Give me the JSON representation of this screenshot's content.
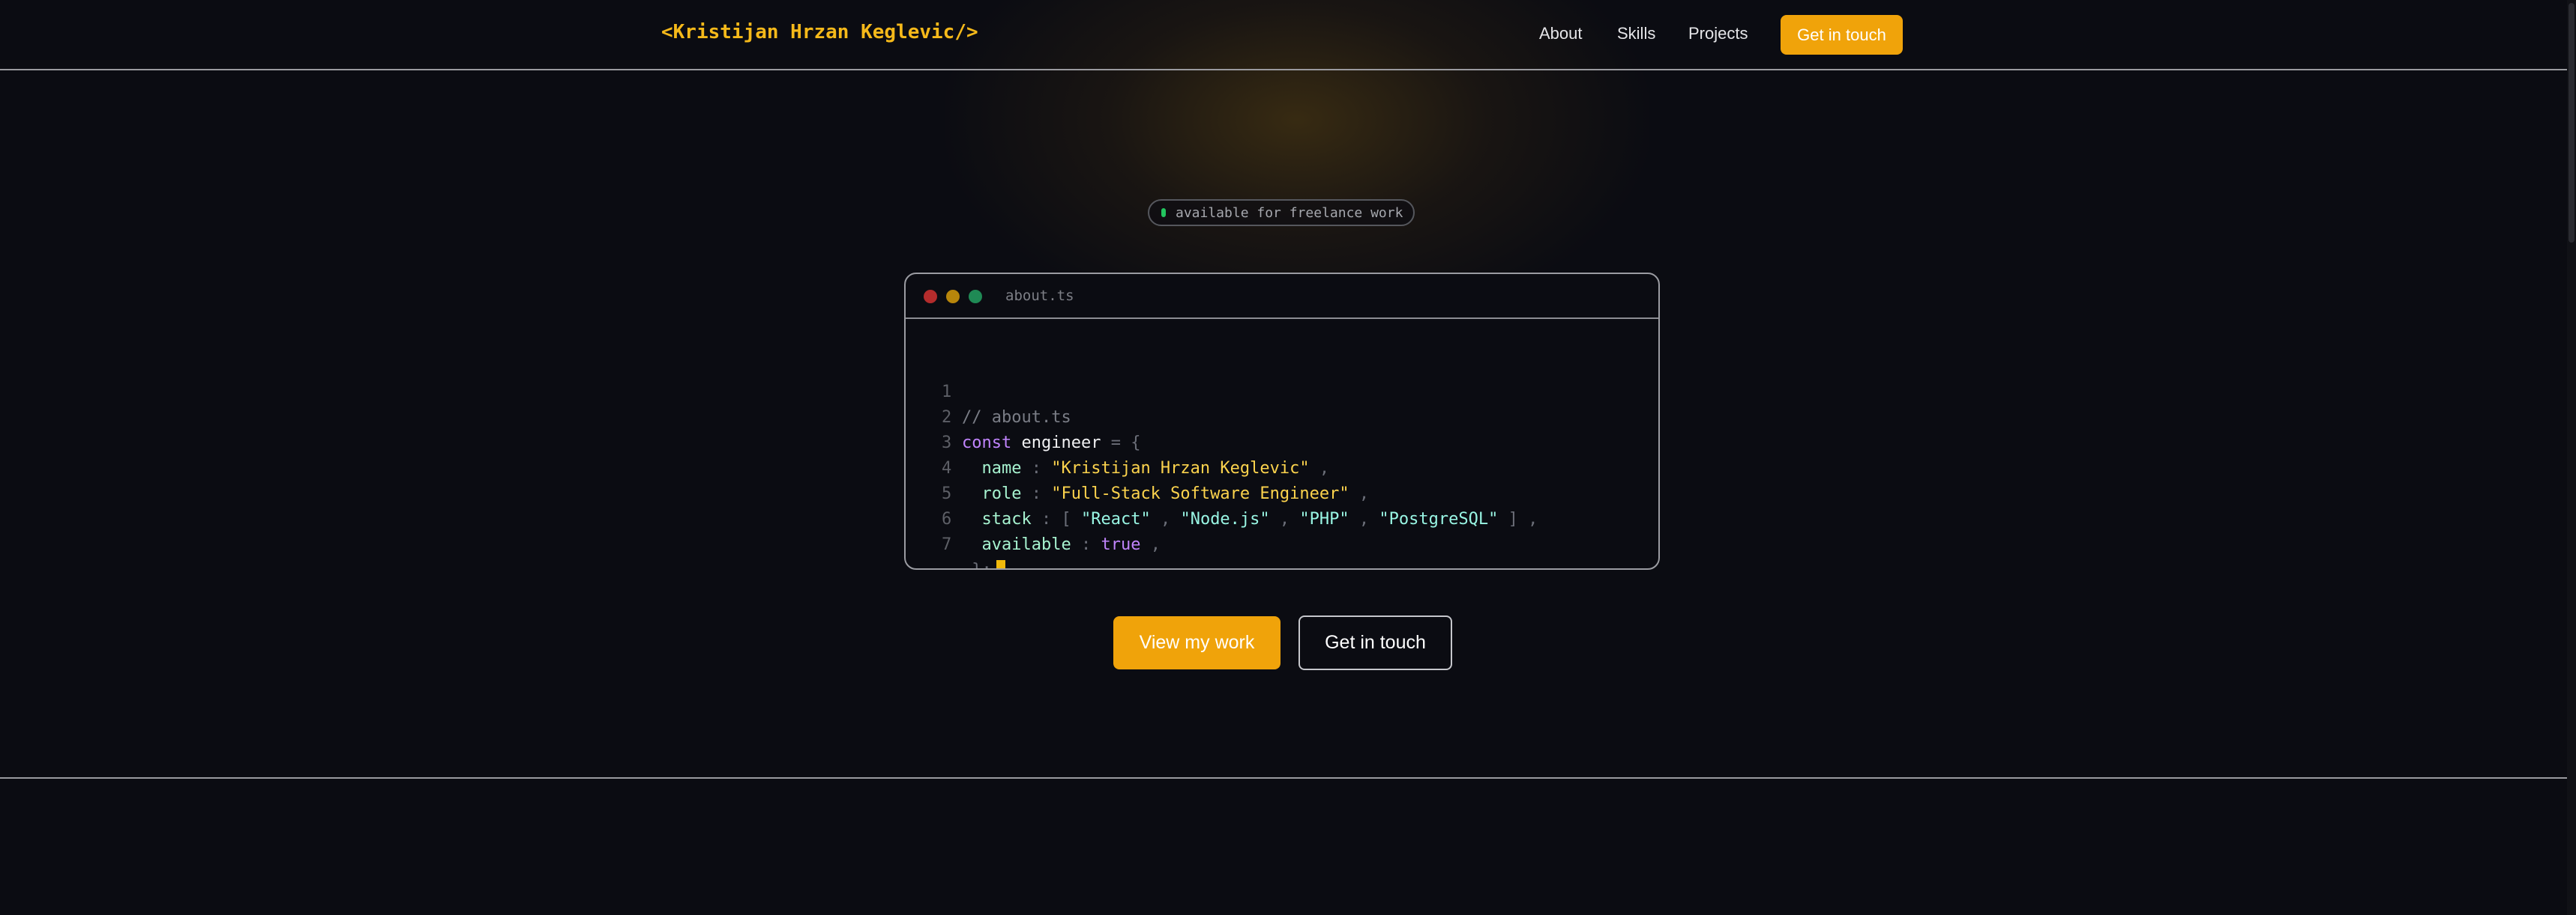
{
  "nav": {
    "logo": "<Kristijan Hrzan Keglevic/>",
    "links": [
      "About",
      "Skills",
      "Projects"
    ],
    "cta": "Get in touch"
  },
  "hero": {
    "badge": "available for freelance work",
    "editor": {
      "filename": "about.ts",
      "line_numbers": [
        "1",
        "2",
        "3",
        "4",
        "5",
        "6",
        "7"
      ],
      "code": {
        "comment": "// about.ts",
        "keyword_const": "const",
        "var_name": "engineer",
        "eq_brace": "= {",
        "name_key": "name",
        "name_value": "\"Kristijan Hrzan Keglevic\"",
        "role_key": "role",
        "role_value": "\"Full-Stack Software Engineer\"",
        "stack_key": "stack",
        "stack_items": [
          "\"React\"",
          "\"Node.js\"",
          "\"PHP\"",
          "\"PostgreSQL\""
        ],
        "available_key": "available",
        "available_value": "true",
        "closing": "};",
        "colon": ":",
        "comma": ",",
        "bracket_open": "[",
        "bracket_close": "]"
      }
    },
    "buttons": {
      "primary": "View my work",
      "secondary": "Get in touch"
    }
  },
  "colors": {
    "background": "#0b0c12",
    "accent": "#f0a30a",
    "logo": "#f5b91a",
    "status_dot": "#22c55e"
  }
}
